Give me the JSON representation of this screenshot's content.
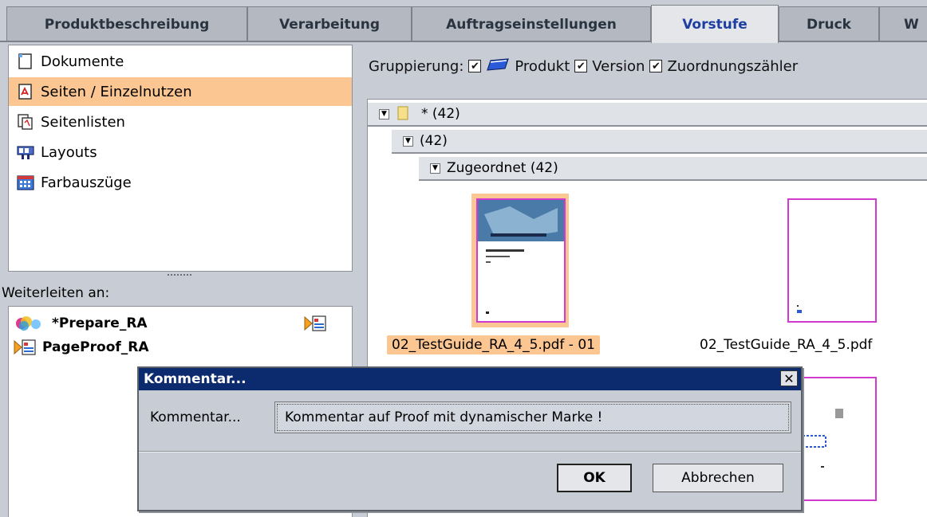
{
  "tabs": [
    {
      "label": "Produktbeschreibung",
      "active": false
    },
    {
      "label": "Verarbeitung",
      "active": false
    },
    {
      "label": "Auftragseinstellungen",
      "active": false
    },
    {
      "label": "Vorstufe",
      "active": true
    },
    {
      "label": "Druck",
      "active": false
    },
    {
      "label": "W",
      "active": false
    }
  ],
  "nav": {
    "items": [
      {
        "label": "Dokumente",
        "icon": "document-icon",
        "selected": false
      },
      {
        "label": "Seiten / Einzelnutzen",
        "icon": "pdf-page-icon",
        "selected": true
      },
      {
        "label": "Seitenlisten",
        "icon": "page-list-icon",
        "selected": false
      },
      {
        "label": "Layouts",
        "icon": "layout-icon",
        "selected": false
      },
      {
        "label": "Farbauszüge",
        "icon": "color-separation-icon",
        "selected": false
      }
    ]
  },
  "forward": {
    "label": "Weiterleiten an:",
    "items": [
      {
        "label": "*Prepare_RA",
        "icon": "color-workflow-icon"
      },
      {
        "label": "PageProof_RA",
        "icon": "pageproof-icon"
      }
    ]
  },
  "grouping": {
    "label": "Gruppierung:",
    "options": [
      {
        "label": "Produkt",
        "checked": true,
        "icon": "product-icon"
      },
      {
        "label": "Version",
        "checked": true
      },
      {
        "label": "Zuordnungszähler",
        "checked": true
      }
    ]
  },
  "tree": {
    "row1": "* (42)",
    "row2": "(42)",
    "row3": "Zugeordnet (42)"
  },
  "pages": [
    {
      "label": "02_TestGuide_RA_4_5.pdf - 01",
      "selected": true
    },
    {
      "label": "02_TestGuide_RA_4_5.pdf",
      "selected": false
    }
  ],
  "dialog": {
    "title": "Kommentar...",
    "field_label": "Kommentar...",
    "field_value": "Kommentar auf Proof mit dynamischer Marke !",
    "ok_label": "OK",
    "cancel_label": "Abbrechen"
  },
  "colors": {
    "selection": "#fbc691",
    "active_tab_text": "#1e3fa0",
    "dialog_title_bg": "#0c2a6e",
    "thumb_border": "#d03ad0"
  }
}
